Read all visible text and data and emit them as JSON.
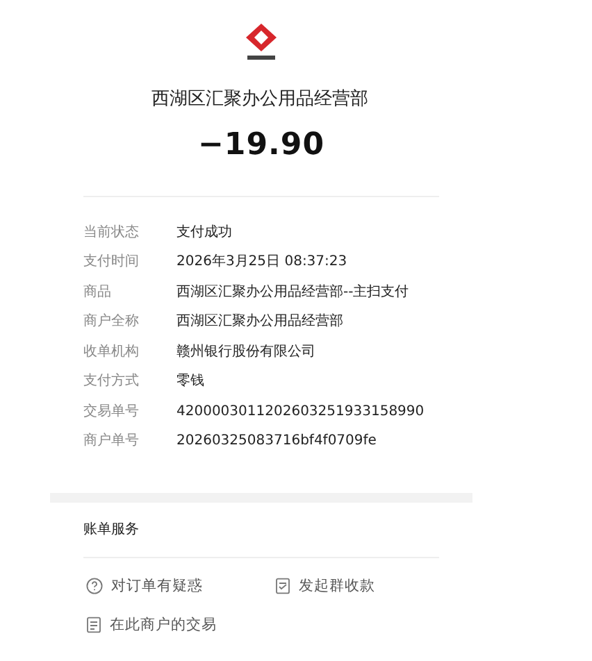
{
  "merchant": "西湖区汇聚办公用品经营部",
  "amount": "−19.90",
  "details": [
    {
      "label": "当前状态",
      "value": "支付成功"
    },
    {
      "label": "支付时间",
      "value": "2026年3月25日 08:37:23"
    },
    {
      "label": "商品",
      "value": "西湖区汇聚办公用品经营部--主扫支付"
    },
    {
      "label": "商户全称",
      "value": "西湖区汇聚办公用品经营部"
    },
    {
      "label": "收单机构",
      "value": "赣州银行股份有限公司"
    },
    {
      "label": "支付方式",
      "value": "零钱"
    },
    {
      "label": "交易单号",
      "value": "4200003011202603251933158990"
    },
    {
      "label": "商户单号",
      "value": "20260325083716bf4f0709fe"
    }
  ],
  "services": {
    "title": "账单服务",
    "actions": [
      {
        "kind": "question",
        "label": "对订单有疑惑"
      },
      {
        "kind": "bill",
        "label": "发起群收款"
      },
      {
        "kind": "list",
        "label": "在此商户的交易"
      }
    ]
  }
}
